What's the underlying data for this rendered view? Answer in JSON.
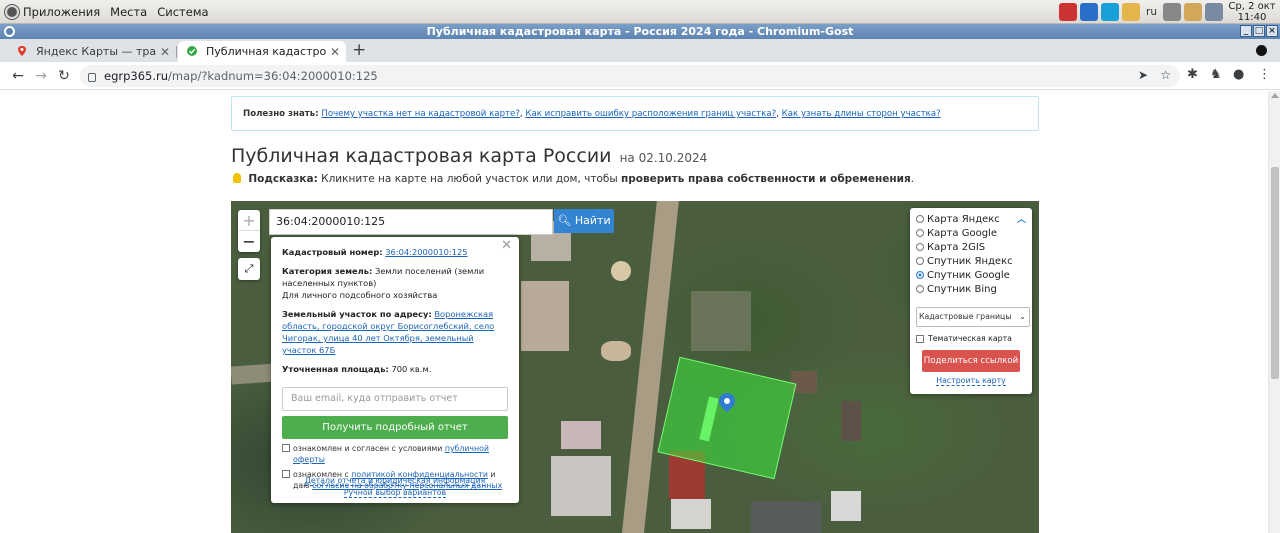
{
  "desktop_panel": {
    "menu": [
      "Приложения",
      "Места",
      "Система"
    ],
    "lang": "ru",
    "clock_line1": "Ср,  2 окт",
    "clock_line2": "11:40"
  },
  "window": {
    "title": "Публичная кадастровая карта - Россия 2024 года - Chromium-Gost"
  },
  "tabs": [
    {
      "label": "Яндекс Карты — транспо",
      "icon": "map-pin-icon",
      "active": false
    },
    {
      "label": "Публичная кадастровая ка",
      "icon": "check-circle-icon",
      "active": true
    }
  ],
  "address_bar": {
    "host": "egrp365.ru",
    "path": "/map/?kadnum=36:04:2000010:125"
  },
  "infobox": {
    "label": "Полезно знать:",
    "links": [
      "Почему участка нет на кадастровой карте?",
      "Как исправить ошибку расположения границ участка?",
      "Как узнать длины сторон участка?"
    ]
  },
  "heading": {
    "title": "Публичная кадастровая карта России",
    "date": "на 02.10.2024"
  },
  "hint": {
    "label": "Подсказка:",
    "text": "Кликните на карте на любой участок или дом, чтобы",
    "emph": "проверить права собственности и обременения",
    "end": "."
  },
  "map": {
    "search_value": "36:04:2000010:125",
    "find_label": "Найти",
    "zoom_in": "+",
    "zoom_out": "−",
    "fullscreen": "⤢"
  },
  "popup": {
    "cad_label": "Кадастровый номер:",
    "cad_value": "36:04:2000010:125",
    "cat_label": "Категория земель:",
    "cat_value": "Земли поселений (земли населенных пунктов)",
    "cat_use": "Для личного подсобного хозяйства",
    "addr_label": "Земельный участок по адресу:",
    "addr_value": "Воронежская область, городской округ Борисоглебский, село Чигорак, улица 40 лет Октября, земельный участок 67Б",
    "area_label": "Уточненная площадь:",
    "area_value": "700 кв.м.",
    "email_placeholder": "Ваш email, куда отправить отчет",
    "get_report": "Получить подробный отчет",
    "agree1_text": "ознакомлен и согласен с условиями",
    "agree1_link": "публичной оферты",
    "agree2_text": "ознакомлен с",
    "agree2_link1": "политикой конфиденциальности",
    "agree2_mid": "и даю",
    "agree2_link2": "согласие на обработку персональных данных",
    "details_link": "Детали отчета и юридическая информация",
    "manual_link": "Ручной выбор вариантов"
  },
  "layers": {
    "options": [
      "Карта Яндекс",
      "Карта Google",
      "Карта 2GIS",
      "Спутник Яндекс",
      "Спутник Google",
      "Спутник Bing"
    ],
    "selected": "Спутник Google",
    "overlay_select": "Кадастровые границы",
    "thematic": "Тематическая карта",
    "share": "Поделиться ссылкой",
    "configure": "Настроить карту"
  }
}
